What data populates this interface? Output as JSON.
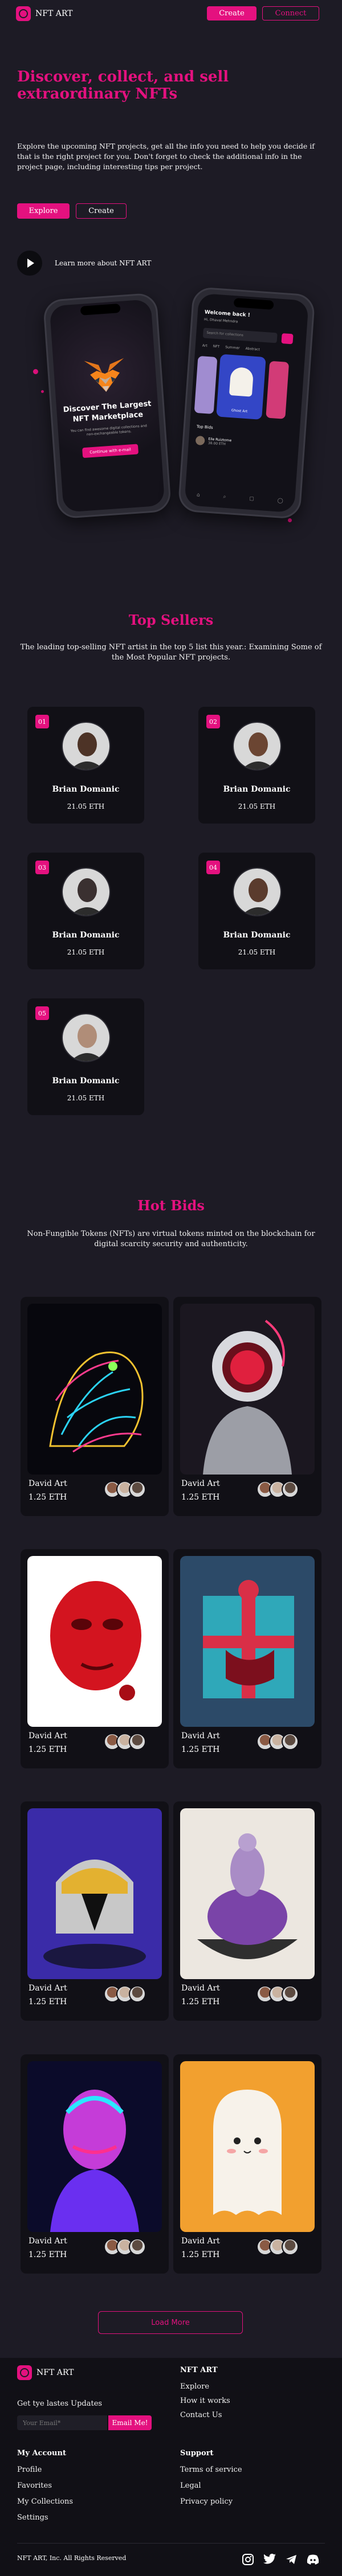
{
  "header": {
    "brand": "NFT ART",
    "create_label": "Create",
    "connect_label": "Connect"
  },
  "hero": {
    "title": "Discover, collect, and sell extraordinary NFTs",
    "text": "Explore the upcoming NFT projects, get all the info you need to help you decide if that is the right project for you. Don't forget to check the additional info in the project page, including interesting tips per project.",
    "explore_label": "Explore",
    "create_label": "Create",
    "video_label": "Learn more about NFT ART"
  },
  "phones": {
    "left": {
      "title": "Discover The Largest NFT Marketplace",
      "text": "You can find awesome digital collections and non-exchangeable tokens.",
      "button": "Continue with e-mail"
    },
    "right": {
      "greeting": "Welcome back !",
      "user": "Hi, Dhaval Mehndra",
      "search": "Search for collections",
      "tabs": [
        "Art",
        "NFT",
        "Summer",
        "Abstract"
      ],
      "card_label": "Ghost Art",
      "section": "Top Bids",
      "bidder": "Elle Ruiztome",
      "bid_value": "38.00 ETH"
    }
  },
  "top_sellers": {
    "title": "Top Sellers",
    "subtitle": "The leading top-selling NFT artist in the top 5 list this year.: Examining Some of the Most Popular NFT projects.",
    "sellers": [
      {
        "rank": "01",
        "name": "Brian Domanic",
        "value": "21.05 ETH",
        "tone": "#4d3326"
      },
      {
        "rank": "02",
        "name": "Brian Domanic",
        "value": "21.05 ETH",
        "tone": "#6b4532"
      },
      {
        "rank": "03",
        "name": "Brian Domanic",
        "value": "21.05 ETH",
        "tone": "#3a3030"
      },
      {
        "rank": "04",
        "name": "Brian Domanic",
        "value": "21.05 ETH",
        "tone": "#5a3b2d"
      },
      {
        "rank": "05",
        "name": "Brian Domanic",
        "value": "21.05 ETH",
        "tone": "#b08d78"
      }
    ]
  },
  "hot_bids": {
    "title": "Hot Bids",
    "subtitle": "Non-Fungible Tokens (NFTs) are virtual tokens minted on the blockchain for digital scarcity security and authenticity.",
    "items": [
      {
        "name": "David Art",
        "price": "1.25 ETH",
        "art": "tiger"
      },
      {
        "name": "David Art",
        "price": "1.25 ETH",
        "art": "astronaut"
      },
      {
        "name": "David Art",
        "price": "1.25 ETH",
        "art": "red-head"
      },
      {
        "name": "David Art",
        "price": "1.25 ETH",
        "art": "gift-box"
      },
      {
        "name": "David Art",
        "price": "1.25 ETH",
        "art": "helmet"
      },
      {
        "name": "David Art",
        "price": "1.25 ETH",
        "art": "furry-figure"
      },
      {
        "name": "David Art",
        "price": "1.25 ETH",
        "art": "neon-bust"
      },
      {
        "name": "David Art",
        "price": "1.25 ETH",
        "art": "ghost"
      }
    ],
    "load_more": "Load More"
  },
  "footer": {
    "brand": "NFT ART",
    "newsletter_title": "Get tye lastes Updates",
    "email_placeholder": "Your Email*",
    "email_button": "Email Me!",
    "col_nft": {
      "heading": "NFT ART",
      "links": [
        "Explore",
        "How it works",
        "Contact Us"
      ]
    },
    "col_account": {
      "heading": "My Account",
      "links": [
        "Profile",
        "Favorites",
        "My Collections",
        "Settings"
      ]
    },
    "col_support": {
      "heading": "Support",
      "links": [
        "Terms of service",
        "Legal",
        "Privacy policy"
      ]
    },
    "copyright": "NFT ART, Inc. All Rights Reserved",
    "socials": [
      "instagram-icon",
      "twitter-icon",
      "telegram-icon",
      "discord-icon"
    ]
  },
  "colors": {
    "accent": "#e4117f",
    "background": "#1d1b25",
    "card": "#111016"
  }
}
